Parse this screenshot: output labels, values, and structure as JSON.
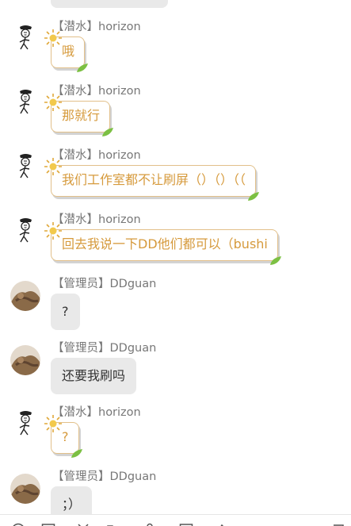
{
  "messages": [
    {
      "sender": "【潜水】horizon",
      "text": "哦",
      "role": "diver"
    },
    {
      "sender": "【潜水】horizon",
      "text": "那就行",
      "role": "diver"
    },
    {
      "sender": "【潜水】horizon",
      "text": "我们工作室都不让刷屏（）（）（（",
      "role": "diver"
    },
    {
      "sender": "【潜水】horizon",
      "text": "回去我说一下DD他们都可以（bushi",
      "role": "diver"
    },
    {
      "sender": "【管理员】DDguan",
      "text": "?",
      "role": "admin"
    },
    {
      "sender": "【管理员】DDguan",
      "text": "还要我刷吗",
      "role": "admin"
    },
    {
      "sender": "【潜水】horizon",
      "text": "?",
      "role": "diver"
    },
    {
      "sender": "【管理员】DDguan",
      "text": "；）",
      "role": "admin"
    }
  ],
  "colors": {
    "diver_text": "#d69a3c",
    "diver_border": "#e2c08a",
    "admin_bubble": "#e9e9e9",
    "admin_text": "#333333",
    "name_text": "#777777"
  },
  "icons": {
    "diver_avatar": "stick-figure-avatar",
    "admin_avatar": "photo-avatar",
    "bubble_decoration": [
      "sun-icon",
      "leaf-icon"
    ],
    "toolbar": [
      "emoji-icon",
      "image-icon",
      "scissors-icon",
      "folder-icon",
      "mic-icon",
      "more-icon"
    ]
  }
}
